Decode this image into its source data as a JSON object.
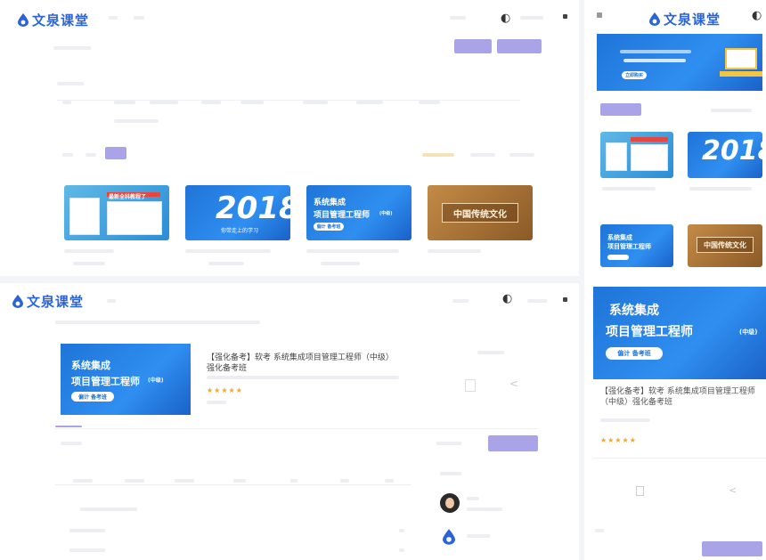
{
  "brand": {
    "name": "文泉课堂"
  },
  "panel_tl": {
    "thumbs": [
      {
        "kind": "exam",
        "banner": "最新全科教程了"
      },
      {
        "kind": "year",
        "year": "2018",
        "caption": "你带走上的学习"
      },
      {
        "kind": "course",
        "title_line1": "系统集成",
        "title_line2": "项目管理工程师",
        "level": "(中级)",
        "pill": "偏计 备考班"
      },
      {
        "kind": "culture",
        "title": "中国传统文化"
      }
    ]
  },
  "panel_tr": {
    "banner_pill": "立即购买",
    "thumbs": [
      {
        "kind": "exam"
      },
      {
        "kind": "year",
        "year": "2018"
      },
      {
        "kind": "course",
        "title_line1": "系统集成",
        "title_line2": "项目管理工程师"
      },
      {
        "kind": "culture",
        "title": "中国传统文化"
      }
    ]
  },
  "panel_bl": {
    "course_title_line1": "系统集成",
    "course_title_line2": "项目管理工程师",
    "course_level": "(中级)",
    "course_pill": "偏计 备考班",
    "product_title_line1": "【强化备考】软考 系统集成项目管理工程师（中级）",
    "product_title_line2": "强化备考班",
    "rating": "★★★★★"
  },
  "panel_br": {
    "hero_line1": "系统集成",
    "hero_line2": "项目管理工程师",
    "hero_level": "(中级)",
    "hero_pill": "偏计 备考班",
    "product_title": "【强化备考】软考 系统集成项目管理工程师（中级）强化备考班",
    "rating": "★★★★★"
  },
  "colors": {
    "accent": "#a9a3e8",
    "brand_blue": "#2b64d8",
    "course_blue": "#1f74d8",
    "star": "#f5a623"
  },
  "icons": [
    "logo-drop-icon",
    "moon-icon",
    "avatar-icon",
    "share-icon",
    "bookmark-icon"
  ]
}
